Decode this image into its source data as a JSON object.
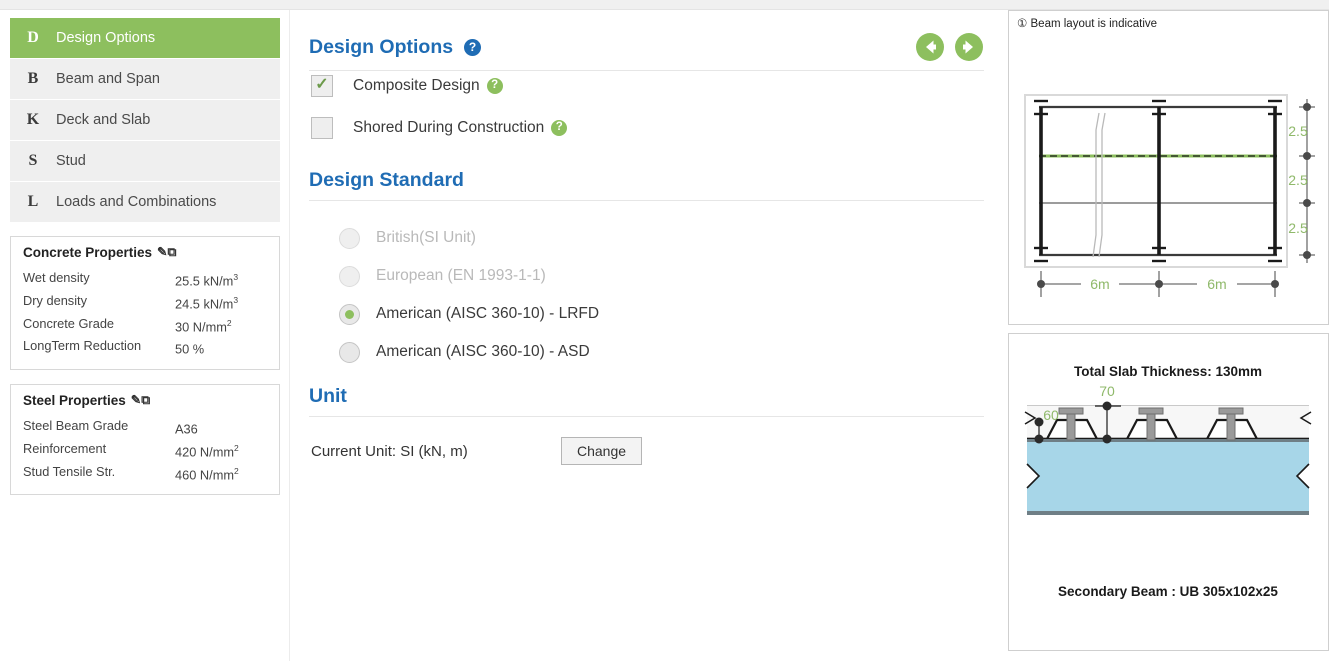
{
  "sidebar": {
    "items": [
      {
        "key": "D",
        "label": "Design Options",
        "active": true
      },
      {
        "key": "B",
        "label": "Beam and Span",
        "active": false
      },
      {
        "key": "K",
        "label": "Deck and Slab",
        "active": false
      },
      {
        "key": "S",
        "label": "Stud",
        "active": false
      },
      {
        "key": "L",
        "label": "Loads and Combinations",
        "active": false
      }
    ],
    "concrete": {
      "title": "Concrete Properties",
      "edit_icon": "edit-icon",
      "rows": [
        {
          "k": "Wet density",
          "v": "25.5 kN/m",
          "sup": "3"
        },
        {
          "k": "Dry density",
          "v": "24.5 kN/m",
          "sup": "3"
        },
        {
          "k": "Concrete Grade",
          "v": "30 N/mm",
          "sup": "2"
        },
        {
          "k": "LongTerm Reduction",
          "v": "50 %",
          "sup": ""
        }
      ]
    },
    "steel": {
      "title": "Steel Properties",
      "edit_icon": "edit-icon",
      "rows": [
        {
          "k": "Steel Beam Grade",
          "v": "A36",
          "sup": ""
        },
        {
          "k": "Reinforcement",
          "v": "420 N/mm",
          "sup": "2"
        },
        {
          "k": "Stud Tensile Str.",
          "v": "460 N/mm",
          "sup": "2"
        }
      ]
    }
  },
  "main": {
    "title": "Design Options",
    "title_help_icon": "help-circle-icon",
    "nav_prev_icon": "arrow-left-circle-icon",
    "nav_next_icon": "arrow-right-circle-icon",
    "checkboxes": [
      {
        "label": "Composite Design",
        "checked": true,
        "check_glyph": "✓",
        "help_icon": "help-circle-icon"
      },
      {
        "label": "Shored During Construction",
        "checked": false,
        "check_glyph": "",
        "help_icon": "help-circle-icon"
      }
    ],
    "standard_title": "Design Standard",
    "standards": [
      {
        "label": "British(SI Unit)",
        "selected": false,
        "disabled": true
      },
      {
        "label": "European (EN 1993-1-1)",
        "selected": false,
        "disabled": true
      },
      {
        "label": "American (AISC 360-10) - LRFD",
        "selected": true,
        "disabled": false
      },
      {
        "label": "American (AISC 360-10) - ASD",
        "selected": false,
        "disabled": false
      }
    ],
    "unit_title": "Unit",
    "unit_current": "Current Unit: SI (kN, m)",
    "unit_change_label": "Change"
  },
  "right": {
    "beam_card": {
      "note_icon": "info-circle-icon",
      "note": "① Beam layout is indicative",
      "bay_widths": [
        "2.5",
        "2.5",
        "2.5"
      ],
      "spans": [
        "6m",
        "6m"
      ]
    },
    "slab_card": {
      "thickness_label": "Total Slab Thickness: 130mm",
      "dim_top": "70",
      "dim_left": "60",
      "caption": "Secondary Beam : UB 305x102x25"
    }
  },
  "colors": {
    "accent_green": "#8dbf5e",
    "heading_blue": "#1f6cb4",
    "dim_green": "#8fb96a",
    "concrete_blue": "#a7d6e8"
  }
}
